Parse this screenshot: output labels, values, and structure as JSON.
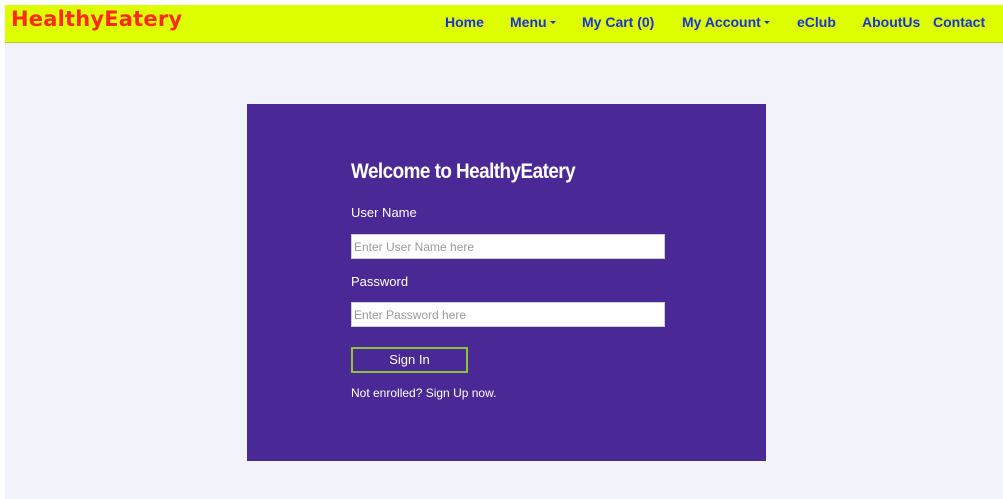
{
  "brand": {
    "name": "HealthyEatery"
  },
  "nav": {
    "home": "Home",
    "menu": "Menu",
    "cart": "My Cart (0)",
    "account": "My Account",
    "eclub": "eClub",
    "about": "AboutUs",
    "contact": "Contact"
  },
  "login": {
    "title": "Welcome to HealthyEatery",
    "username_label": "User Name",
    "username_placeholder": "Enter User Name here",
    "username_value": "",
    "password_label": "Password",
    "password_placeholder": "Enter Password here",
    "password_value": "",
    "signin_label": "Sign In",
    "signup_text": "Not enrolled? Sign Up now."
  },
  "colors": {
    "navbar_bg": "#ddff00",
    "brand": "#ff2a1a",
    "nav_link": "#1a33d6",
    "panel_bg": "#4a2896",
    "button_border": "#8cc43a",
    "page_bg": "#f2f2fa"
  },
  "icons": {
    "dropdown": "chevron-down-icon"
  }
}
